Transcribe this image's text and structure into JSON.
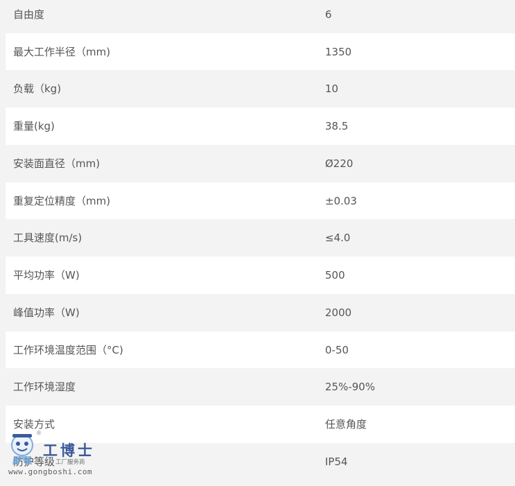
{
  "specs": {
    "rows": [
      {
        "label": "自由度",
        "value": "6"
      },
      {
        "label": "最大工作半径（mm)",
        "value": "1350"
      },
      {
        "label": "负载（kg)",
        "value": "10"
      },
      {
        "label": "重量(kg)",
        "value": "38.5"
      },
      {
        "label": "安装面直径（mm)",
        "value": "Ø220"
      },
      {
        "label": "重复定位精度（mm)",
        "value": "±0.03"
      },
      {
        "label": "工具速度(m/s)",
        "value": "≤4.0"
      },
      {
        "label": "平均功率（W)",
        "value": "500"
      },
      {
        "label": "峰值功率（W)",
        "value": "2000"
      },
      {
        "label": "工作环境温度范围（°C)",
        "value": "0-50"
      },
      {
        "label": "工作环境湿度",
        "value": "25%-90%"
      },
      {
        "label": "安装方式",
        "value": "任意角度"
      },
      {
        "label": "防护等级",
        "value": "IP54"
      }
    ]
  },
  "watermark": {
    "title": "工博士",
    "subtitle": "工厂服务商",
    "registered": "®",
    "url": "www.gongboshi.com",
    "brand_color": "#1a3f8a",
    "mascot_icon": "robot-mascot-icon"
  },
  "colors": {
    "row_light": "#ffffff",
    "row_dark": "#f3f3f3",
    "text": "#555555"
  }
}
